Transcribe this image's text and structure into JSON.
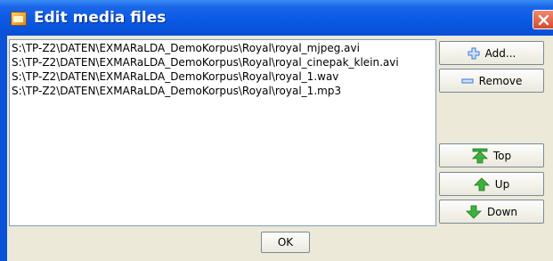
{
  "window": {
    "title": "Edit media files"
  },
  "media_files": [
    "S:\\TP-Z2\\DATEN\\EXMARaLDA_DemoKorpus\\Royal\\royal_mjpeg.avi",
    "S:\\TP-Z2\\DATEN\\EXMARaLDA_DemoKorpus\\Royal\\royal_cinepak_klein.avi",
    "S:\\TP-Z2\\DATEN\\EXMARaLDA_DemoKorpus\\Royal\\royal_1.wav",
    "S:\\TP-Z2\\DATEN\\EXMARaLDA_DemoKorpus\\Royal\\royal_1.mp3"
  ],
  "buttons": {
    "add": "Add...",
    "remove": "Remove",
    "top": "Top",
    "up": "Up",
    "down": "Down",
    "ok": "OK"
  },
  "colors": {
    "titlebar": "#0a58e3",
    "panel": "#ece9d8",
    "arrow_green": "#3cb13c",
    "plus_blue": "#3a78d8"
  }
}
